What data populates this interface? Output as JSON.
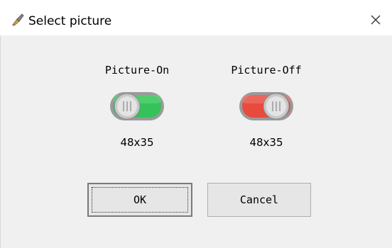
{
  "window": {
    "title": "Select picture",
    "icon": "paintbrush-icon",
    "close_icon": "close-icon"
  },
  "pictures": [
    {
      "label": "Picture-On",
      "size": "48x35",
      "state": "on",
      "color": "#35c25a"
    },
    {
      "label": "Picture-Off",
      "size": "48x35",
      "state": "off",
      "color": "#e84a3c"
    }
  ],
  "buttons": {
    "ok_label": "OK",
    "cancel_label": "Cancel"
  }
}
